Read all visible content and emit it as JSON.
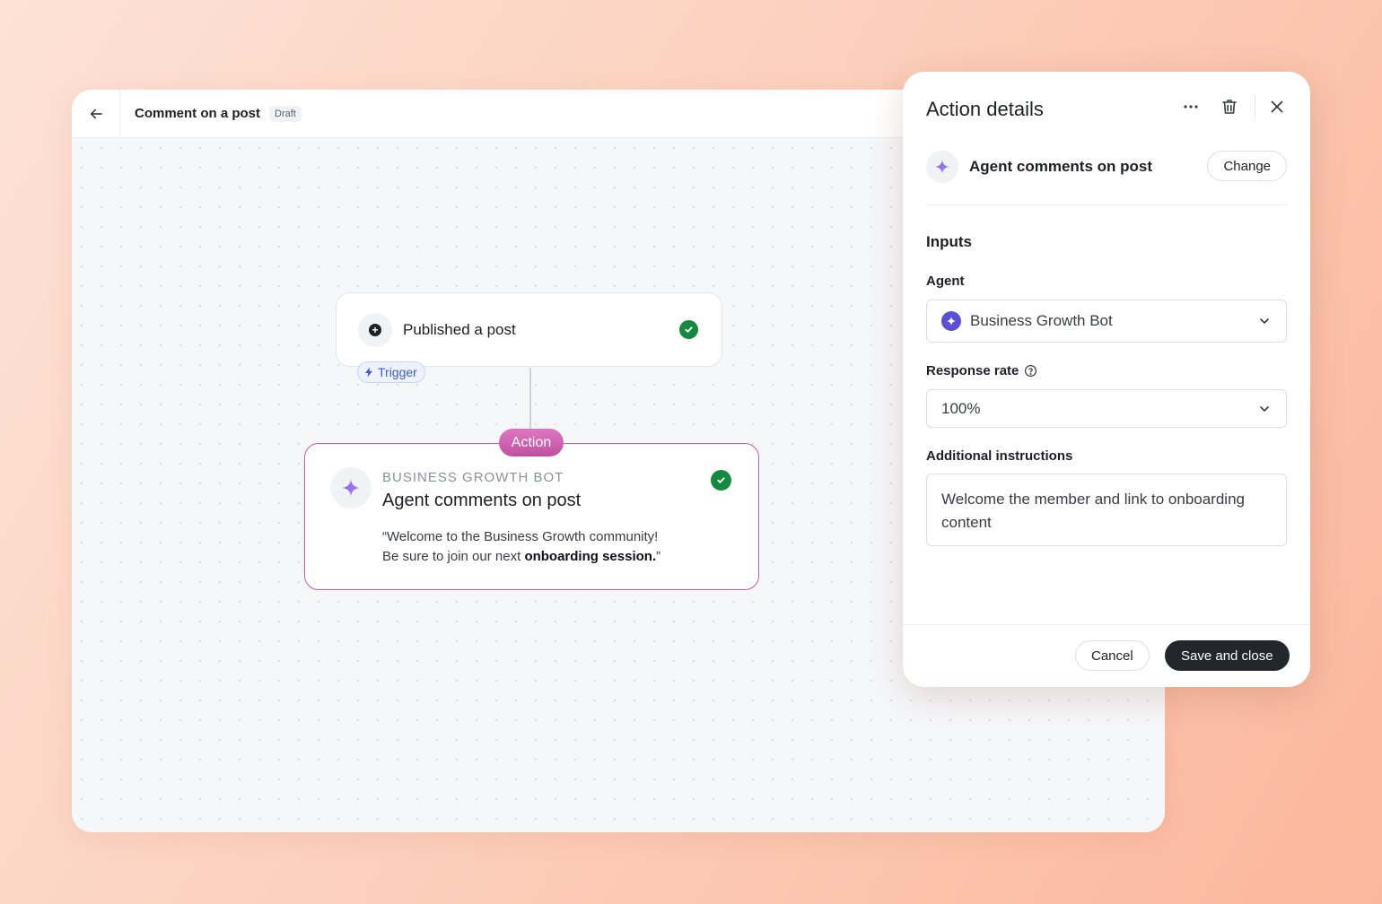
{
  "header": {
    "title": "Comment on a post",
    "status_badge": "Draft"
  },
  "workflow": {
    "trigger": {
      "label": "Published a post",
      "pill": "Trigger",
      "icon": "plus-circle-icon",
      "status": "complete"
    },
    "action": {
      "pill": "Action",
      "eyebrow": "BUSINESS GROWTH BOT",
      "title": "Agent comments on post",
      "quote_line1": "“Welcome to the Business Growth community!",
      "quote_line2_prefix": "Be sure to join our next ",
      "quote_line2_bold": "onboarding session.",
      "quote_line2_suffix": "”",
      "icon": "sparkle-icon",
      "status": "complete"
    }
  },
  "panel": {
    "title": "Action details",
    "action_name": "Agent comments on post",
    "change_label": "Change",
    "inputs_heading": "Inputs",
    "agent_label": "Agent",
    "agent_value": "Business Growth Bot",
    "rate_label": "Response rate",
    "rate_value": "100%",
    "instructions_label": "Additional instructions",
    "instructions_value": "Welcome the member and link to onboarding content",
    "cancel_label": "Cancel",
    "save_label": "Save and close"
  },
  "colors": {
    "accent_action": "#c85ab0",
    "success": "#138a3d",
    "agent_dot": "#5b4fd8",
    "primary_button": "#24262b"
  }
}
